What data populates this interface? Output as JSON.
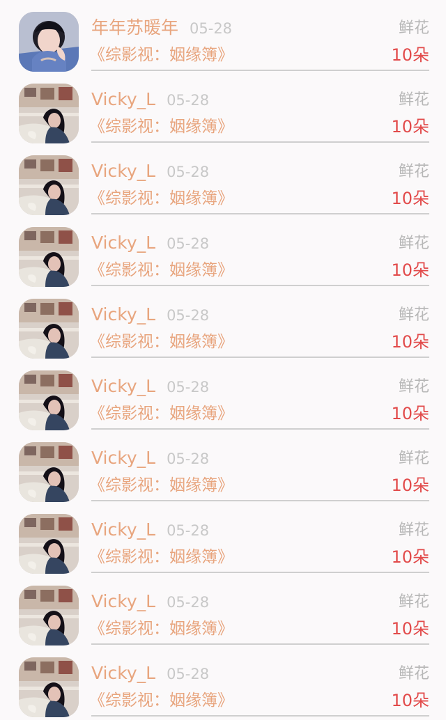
{
  "gift_list": [
    {
      "user_name": "年年苏暖年",
      "date": "05-28",
      "gift_type": "鲜花",
      "work_title": "《综影视：姻缘簿》",
      "gift_count": "10朵",
      "avatar": "avatar-woman-blue-background"
    },
    {
      "user_name": "Vicky_L",
      "date": "05-28",
      "gift_type": "鲜花",
      "work_title": "《综影视：姻缘簿》",
      "gift_count": "10朵",
      "avatar": "avatar-woman-room"
    },
    {
      "user_name": "Vicky_L",
      "date": "05-28",
      "gift_type": "鲜花",
      "work_title": "《综影视：姻缘簿》",
      "gift_count": "10朵",
      "avatar": "avatar-woman-room"
    },
    {
      "user_name": "Vicky_L",
      "date": "05-28",
      "gift_type": "鲜花",
      "work_title": "《综影视：姻缘簿》",
      "gift_count": "10朵",
      "avatar": "avatar-woman-room"
    },
    {
      "user_name": "Vicky_L",
      "date": "05-28",
      "gift_type": "鲜花",
      "work_title": "《综影视：姻缘簿》",
      "gift_count": "10朵",
      "avatar": "avatar-woman-room"
    },
    {
      "user_name": "Vicky_L",
      "date": "05-28",
      "gift_type": "鲜花",
      "work_title": "《综影视：姻缘簿》",
      "gift_count": "10朵",
      "avatar": "avatar-woman-room"
    },
    {
      "user_name": "Vicky_L",
      "date": "05-28",
      "gift_type": "鲜花",
      "work_title": "《综影视：姻缘簿》",
      "gift_count": "10朵",
      "avatar": "avatar-woman-room"
    },
    {
      "user_name": "Vicky_L",
      "date": "05-28",
      "gift_type": "鲜花",
      "work_title": "《综影视：姻缘簿》",
      "gift_count": "10朵",
      "avatar": "avatar-woman-room"
    },
    {
      "user_name": "Vicky_L",
      "date": "05-28",
      "gift_type": "鲜花",
      "work_title": "《综影视：姻缘簿》",
      "gift_count": "10朵",
      "avatar": "avatar-woman-room"
    },
    {
      "user_name": "Vicky_L",
      "date": "05-28",
      "gift_type": "鲜花",
      "work_title": "《综影视：姻缘簿》",
      "gift_count": "10朵",
      "avatar": "avatar-woman-room"
    }
  ],
  "colors": {
    "background": "#fbf9fa",
    "name_and_title": "#e8a57e",
    "date": "#c8c8c8",
    "gift_type": "#b7b7b7",
    "gift_count": "#e24b4b",
    "divider": "#cfcfcf"
  }
}
